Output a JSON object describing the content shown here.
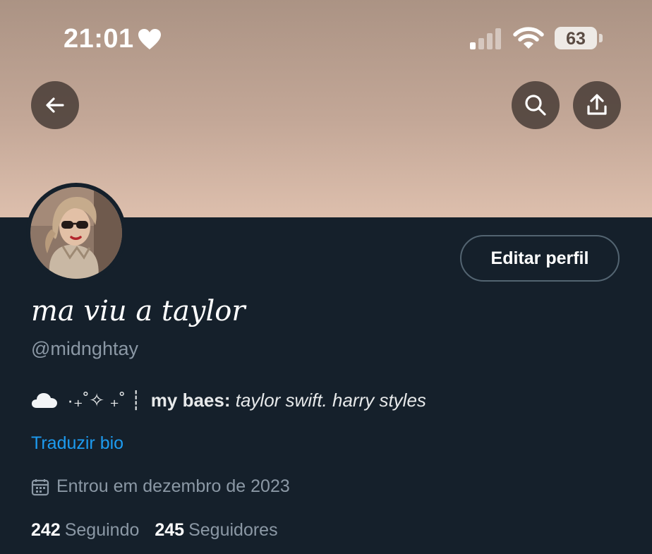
{
  "status_bar": {
    "time": "21:01",
    "battery": "63"
  },
  "profile": {
    "display_name": "ma viu a taylor",
    "handle": "@midnghtay",
    "edit_button": "Editar perfil",
    "bio": {
      "decoration": "·₊˚✧ ₊˚ ┊",
      "bold": "my baes:",
      "italic": "taylor swift. harry styles"
    },
    "translate_label": "Traduzir bio",
    "joined": "Entrou em dezembro de 2023",
    "following_count": "242",
    "following_label": "Seguindo",
    "followers_count": "245",
    "followers_label": "Seguidores"
  },
  "icons": {
    "status": [
      "heart-icon",
      "signal-icon",
      "wifi-icon",
      "battery-icon"
    ],
    "header": [
      "back-arrow-icon",
      "search-icon",
      "share-icon"
    ],
    "bio": [
      "cloud-icon"
    ],
    "meta": [
      "calendar-icon"
    ]
  },
  "colors": {
    "background": "#15202b",
    "accent_link": "#1d9bf0",
    "secondary_text": "#8b98a5",
    "banner_top": "#ab9384",
    "banner_bottom": "#ddbfad"
  }
}
